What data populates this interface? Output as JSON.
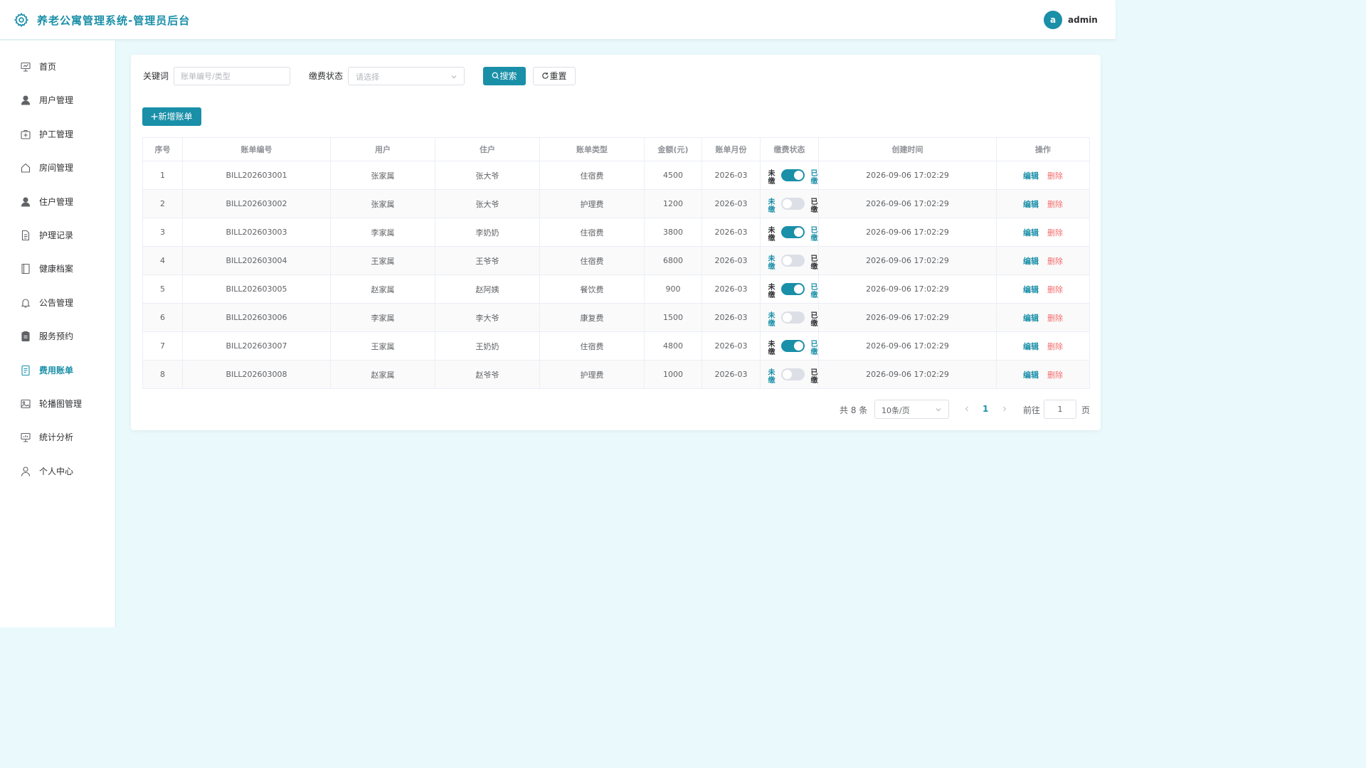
{
  "header": {
    "title": "养老公寓管理系统-管理员后台",
    "avatar_letter": "a",
    "username": "admin"
  },
  "sidebar": {
    "items": [
      {
        "label": "首页",
        "icon": "presentation-icon"
      },
      {
        "label": "用户管理",
        "icon": "user-icon"
      },
      {
        "label": "护工管理",
        "icon": "first-aid-kit-icon"
      },
      {
        "label": "房间管理",
        "icon": "house-icon"
      },
      {
        "label": "住户管理",
        "icon": "user-icon"
      },
      {
        "label": "护理记录",
        "icon": "document-icon"
      },
      {
        "label": "健康档案",
        "icon": "notebook-icon"
      },
      {
        "label": "公告管理",
        "icon": "bell-icon"
      },
      {
        "label": "服务预约",
        "icon": "clipboard-icon"
      },
      {
        "label": "费用账单",
        "icon": "tickets-icon"
      },
      {
        "label": "轮播图管理",
        "icon": "picture-icon"
      },
      {
        "label": "统计分析",
        "icon": "data-board-icon"
      },
      {
        "label": "个人中心",
        "icon": "user-outline-icon"
      }
    ],
    "active": "费用账单"
  },
  "search": {
    "keyword_label": "关键词",
    "keyword_placeholder": "账单编号/类型",
    "keyword_value": "",
    "status_label": "缴费状态",
    "status_placeholder": "请选择",
    "search_button": "搜索",
    "reset_button": "重置"
  },
  "toolbar": {
    "add_button": "新增账单"
  },
  "table": {
    "columns": [
      "序号",
      "账单编号",
      "用户",
      "住户",
      "账单类型",
      "金额(元)",
      "账单月份",
      "缴费状态",
      "创建时间",
      "操作"
    ],
    "status_unpaid": "未缴",
    "status_paid": "已缴",
    "edit_label": "编辑",
    "delete_label": "删除",
    "rows": [
      {
        "index": "1",
        "bill_no": "BILL202603001",
        "user": "张家属",
        "resident": "张大爷",
        "type": "住宿费",
        "amount": "4500",
        "month": "2026-03",
        "paid": true,
        "created": "2026-09-06 17:02:29"
      },
      {
        "index": "2",
        "bill_no": "BILL202603002",
        "user": "张家属",
        "resident": "张大爷",
        "type": "护理费",
        "amount": "1200",
        "month": "2026-03",
        "paid": false,
        "created": "2026-09-06 17:02:29"
      },
      {
        "index": "3",
        "bill_no": "BILL202603003",
        "user": "李家属",
        "resident": "李奶奶",
        "type": "住宿费",
        "amount": "3800",
        "month": "2026-03",
        "paid": true,
        "created": "2026-09-06 17:02:29"
      },
      {
        "index": "4",
        "bill_no": "BILL202603004",
        "user": "王家属",
        "resident": "王爷爷",
        "type": "住宿费",
        "amount": "6800",
        "month": "2026-03",
        "paid": false,
        "created": "2026-09-06 17:02:29"
      },
      {
        "index": "5",
        "bill_no": "BILL202603005",
        "user": "赵家属",
        "resident": "赵阿姨",
        "type": "餐饮费",
        "amount": "900",
        "month": "2026-03",
        "paid": true,
        "created": "2026-09-06 17:02:29"
      },
      {
        "index": "6",
        "bill_no": "BILL202603006",
        "user": "李家属",
        "resident": "李大爷",
        "type": "康复费",
        "amount": "1500",
        "month": "2026-03",
        "paid": false,
        "created": "2026-09-06 17:02:29"
      },
      {
        "index": "7",
        "bill_no": "BILL202603007",
        "user": "王家属",
        "resident": "王奶奶",
        "type": "住宿费",
        "amount": "4800",
        "month": "2026-03",
        "paid": true,
        "created": "2026-09-06 17:02:29"
      },
      {
        "index": "8",
        "bill_no": "BILL202603008",
        "user": "赵家属",
        "resident": "赵爷爷",
        "type": "护理费",
        "amount": "1000",
        "month": "2026-03",
        "paid": false,
        "created": "2026-09-06 17:02:29"
      }
    ]
  },
  "pagination": {
    "total_text": "共 8 条",
    "page_size": "10条/页",
    "current_page": "1",
    "goto_label": "前往",
    "goto_value": "1",
    "page_unit": "页"
  },
  "colors": {
    "primary": "#1a8fa8",
    "danger": "#f56c6c",
    "background": "#eaf9fc"
  }
}
